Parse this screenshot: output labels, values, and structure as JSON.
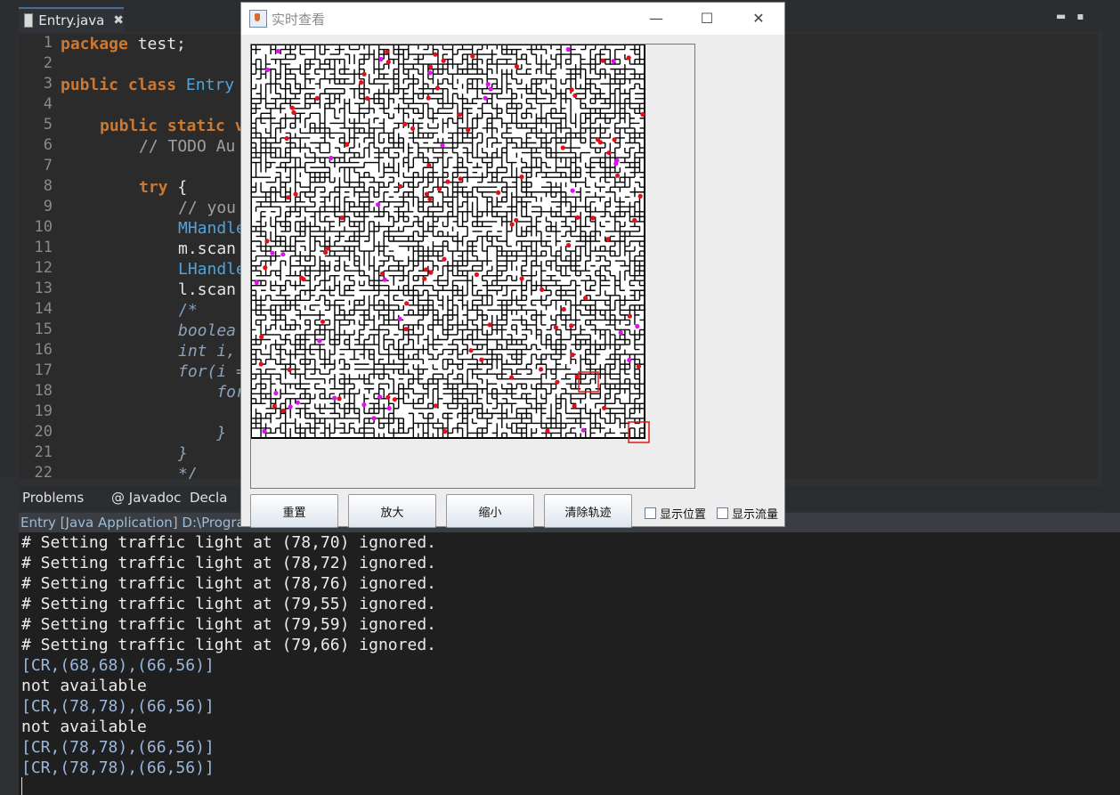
{
  "editor": {
    "tab_label": "Entry.java",
    "tab_close": "✖",
    "line_numbers": [
      "1",
      "2",
      "3",
      "4",
      "5",
      "6",
      "7",
      "8",
      "9",
      "10",
      "11",
      "12",
      "13",
      "14",
      "15",
      "16",
      "17",
      "18",
      "19",
      "20",
      "21",
      "22"
    ],
    "lines": {
      "l1_kw": "package",
      "l1_rest": " test;",
      "l3_kw1": "public",
      "l3_kw2": " class",
      "l3_cls": " Entry",
      "l5_kw1": "public",
      "l5_kw2": " static v",
      "l6_cm": "// TODO Au",
      "l8_kw": "try",
      "l8_rest": " {",
      "l9_cm": "// you",
      "l10_cls": "MHandle",
      "l11_tx": "m.scan",
      "l12_cls": "LHandle",
      "l13_tx": "l.scan",
      "l14_cm": "/*",
      "l15_cm": "boolea",
      "l16_cm": "int i,",
      "l17_cm": "for(i =",
      "l18_cm": "    for",
      "l20_cm": "    }",
      "l21_cm": "}",
      "l22_cm": "*/"
    }
  },
  "console": {
    "tabs": [
      "Problems",
      "@ Javadoc",
      "Decla"
    ],
    "title": "Entry [Java Application] D:\\Program",
    "lines": [
      {
        "text": "# Setting traffic light at (78,70) ignored.",
        "kind": "out"
      },
      {
        "text": "# Setting traffic light at (78,72) ignored.",
        "kind": "out"
      },
      {
        "text": "# Setting traffic light at (78,76) ignored.",
        "kind": "out"
      },
      {
        "text": "# Setting traffic light at (79,55) ignored.",
        "kind": "out"
      },
      {
        "text": "# Setting traffic light at (79,59) ignored.",
        "kind": "out"
      },
      {
        "text": "# Setting traffic light at (79,66) ignored.",
        "kind": "out"
      },
      {
        "text": "[CR,(68,68),(66,56)]",
        "kind": "err"
      },
      {
        "text": "not available",
        "kind": "out"
      },
      {
        "text": "[CR,(78,78),(66,56)]",
        "kind": "err"
      },
      {
        "text": "not available",
        "kind": "out"
      },
      {
        "text": "[CR,(78,78),(66,56)]",
        "kind": "err"
      },
      {
        "text": "[CR,(78,78),(66,56)]",
        "kind": "err"
      }
    ]
  },
  "window": {
    "title": "实时查看",
    "minimize": "—",
    "maximize": "☐",
    "close": "✕",
    "buttons": {
      "reset": "重置",
      "zoom_in": "放大",
      "zoom_out": "缩小",
      "clear_trace": "清除轨迹"
    },
    "checkboxes": {
      "show_position": "显示位置",
      "show_flow": "显示流量"
    }
  },
  "colors": {
    "car_red": "#e0101a",
    "car_magenta": "#e010f0",
    "highlight_box": "#e01818",
    "keyword": "#cc7832",
    "class_name": "#4fa3e0"
  }
}
